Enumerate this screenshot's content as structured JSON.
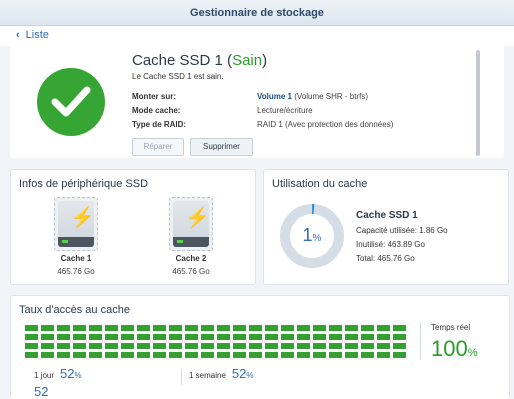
{
  "window": {
    "title": "Gestionnaire de stockage"
  },
  "nav": {
    "back_label": "Liste"
  },
  "summary": {
    "title": "Cache SSD 1",
    "status": "Sain",
    "subtitle": "Le Cache SSD 1 est sain.",
    "rows": [
      {
        "key": "Monter sur:",
        "strong": "Volume 1",
        "value": "(Volume SHR - btrfs)"
      },
      {
        "key": "Mode cache:",
        "strong": "",
        "value": "Lecture/écriture"
      },
      {
        "key": "Type de RAID:",
        "strong": "",
        "value": "RAID 1 (Avec protection des données)"
      }
    ],
    "buttons": {
      "repair": "Réparer",
      "delete": "Supprimer"
    }
  },
  "ssd_info": {
    "title": "Infos de périphérique SSD",
    "drives": [
      {
        "name": "Cache 1",
        "size": "465.76 Go"
      },
      {
        "name": "Cache 2",
        "size": "465.76 Go"
      }
    ]
  },
  "cache_usage": {
    "title": "Utilisation du cache",
    "percent": 1,
    "percent_label": "1",
    "unit": "%",
    "name": "Cache SSD 1",
    "used": "Capacité utilisée: 1.86 Go",
    "unused": "Inutilisé: 463.89 Go",
    "total": "Total: 465.76 Go",
    "colors": {
      "used": "#3a8fd6",
      "free": "#d5dde6"
    }
  },
  "access_rate": {
    "title": "Taux d'accès au cache",
    "realtime_label": "Temps réel",
    "realtime_value": "100",
    "unit": "%",
    "level": 1.0,
    "day_label": "1 jour",
    "day_value": "52",
    "week_label": "1 semaine",
    "week_value": "52",
    "cut_value": "52",
    "bar_color": "#33a131"
  }
}
